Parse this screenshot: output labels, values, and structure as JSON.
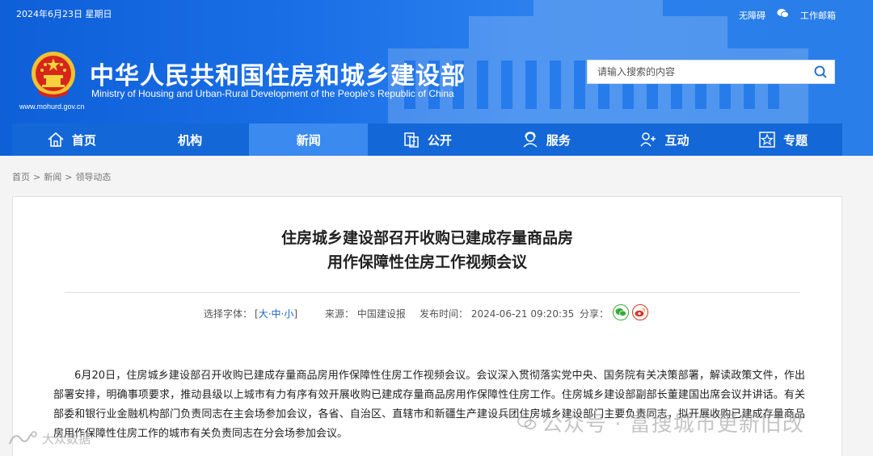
{
  "topbar": {
    "date": "2024年6月23日 星期日",
    "accessibility": "无障碍",
    "wechat_icon": "wechat-icon",
    "work_mail": "工作邮箱"
  },
  "header": {
    "emblem": "national-emblem",
    "site_url": "www.mohurd.gov.cn",
    "title_cn": "中华人民共和国住房和城乡建设部",
    "title_en": "Ministry of Housing and Urban-Rural Development of the People’s Republic of China"
  },
  "search": {
    "placeholder": "请输入搜索的内容",
    "icon": "search-icon"
  },
  "nav": {
    "items": [
      {
        "label": "首页",
        "icon": "home-icon"
      },
      {
        "label": "机构",
        "icon": ""
      },
      {
        "label": "新闻",
        "icon": "",
        "active": true
      },
      {
        "label": "公开",
        "icon": "document-icon"
      },
      {
        "label": "服务",
        "icon": "service-icon"
      },
      {
        "label": "互动",
        "icon": "interaction-icon"
      },
      {
        "label": "专题",
        "icon": "star-icon"
      }
    ]
  },
  "breadcrumb": {
    "home": "首页",
    "sep": ">",
    "news": "新闻",
    "current": "领导动态"
  },
  "article": {
    "title_line1": "住房城乡建设部召开收购已建成存量商品房",
    "title_line2": "用作保障性住房工作视频会议",
    "font_size_label": "选择字体：",
    "font_open": "[",
    "font_large": "大",
    "font_mid": "中",
    "font_small": "小",
    "font_dash": "·",
    "font_close": "]",
    "source": "来源：  中国建设报",
    "publish_time": "发布时间：  2024-06-21 09:20:35",
    "share_label": "分享：",
    "body": "6月20日，住房城乡建设部召开收购已建成存量商品房用作保障性住房工作视频会议。会议深入贯彻落实党中央、国务院有关决策部署，解读政策文件，作出部署安排，明确事项要求，推动县级以上城市有力有序有效开展收购已建成存量商品房用作保障性住房工作。住房城乡建设部副部长董建国出席会议并讲话。有关部委和银行业金融机构部门负责同志在主会场参加会议，各省、自治区、直辖市和新疆生产建设兵团住房城乡建设部门主要负责同志，拟开展收购已建成存量商品房用作保障性住房工作的城市有关负责同志在分会场参加会议。"
  },
  "watermarks": {
    "right": "公众号 · 富搜城市更新旧改",
    "left": "大众数据"
  }
}
